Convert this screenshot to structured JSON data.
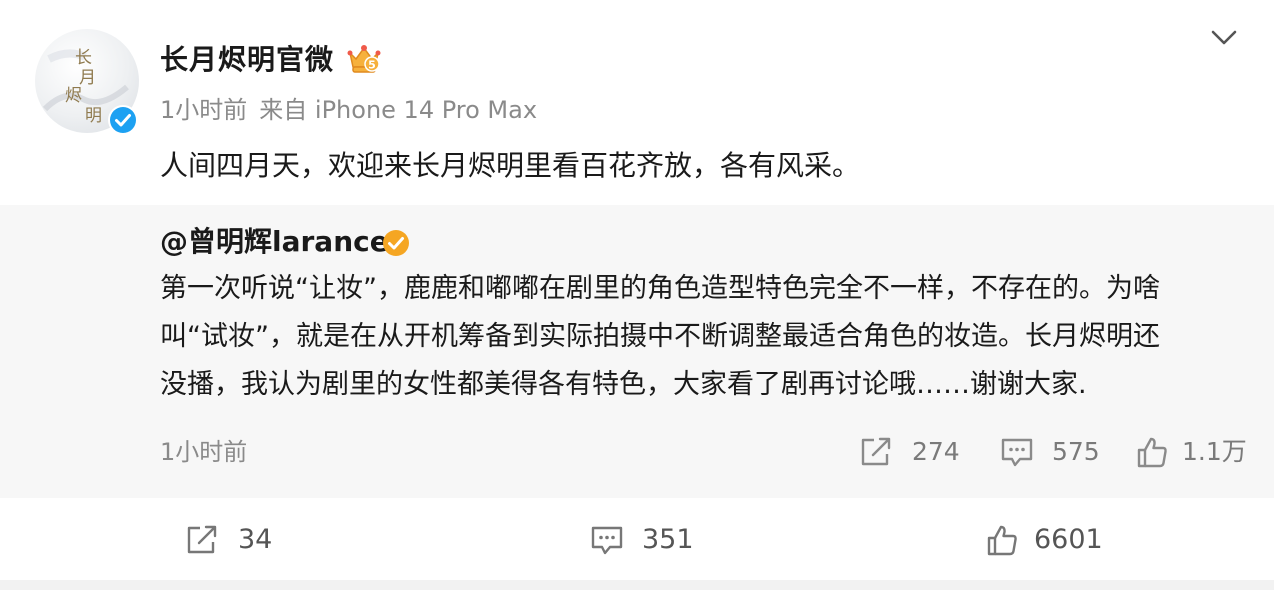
{
  "post": {
    "author": "长月烬明官微",
    "time": "1小时前",
    "source": "来自 iPhone 14 Pro Max",
    "text": "人间四月天，欢迎来长月烬明里看百花齐放，各有风采。",
    "avatar_lettering": "长月烬明",
    "member_badge_level": "5"
  },
  "repost": {
    "author": "@曾明辉larance",
    "lines": [
      "第一次听说“让妆”，鹿鹿和嘟嘟在剧里的角色造型特色完全不一样，不存在的。为啥",
      "叫“试妆”，就是在从开机筹备到实际拍摄中不断调整最适合角色的妆造。长月烬明还",
      "没播，我认为剧里的女性都美得各有特色，大家看了剧再讨论哦……谢谢大家."
    ],
    "time": "1小时前",
    "stats": {
      "reposts": "274",
      "comments": "575",
      "likes": "1.1万"
    }
  },
  "actions": {
    "reposts": "34",
    "comments": "351",
    "likes": "6601"
  },
  "icons": {
    "verified": "verified-blue-check-icon",
    "member": "crown-member-icon",
    "repost_verified": "verified-gold-check-icon",
    "more": "chevron-down-icon",
    "repost": "share-arrow-icon",
    "comment": "comment-bubble-icon",
    "like": "thumbs-up-icon"
  },
  "colors": {
    "verified_blue": "#1da1f2",
    "verified_gold": "#f5a623",
    "muted_text": "#8a8a8a",
    "repost_bg": "#f7f7f7"
  }
}
